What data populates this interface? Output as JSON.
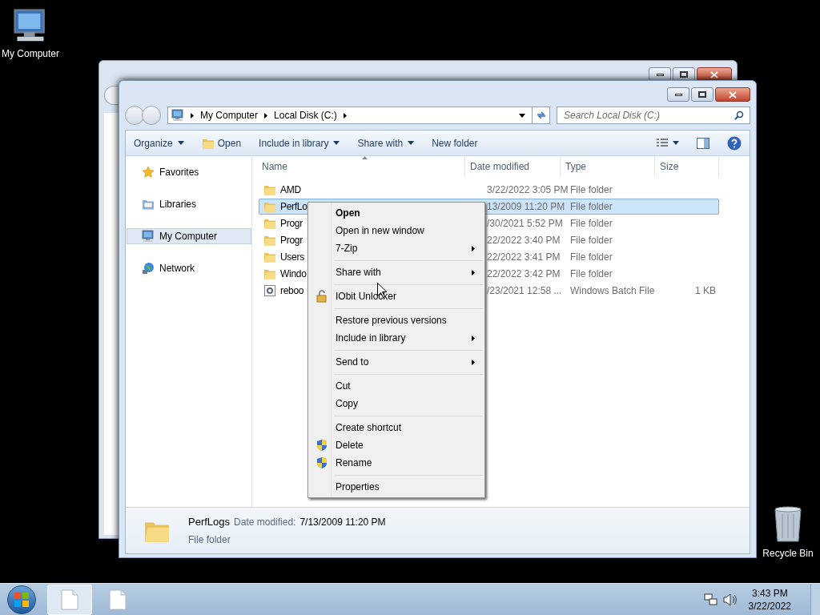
{
  "desktop_icons": [
    {
      "label": "My Computer",
      "kind": "computer"
    },
    {
      "label": "Recycle Bin",
      "kind": "bin"
    }
  ],
  "window": {
    "address": [
      "My Computer",
      "Local Disk (C:)"
    ],
    "search": {
      "placeholder": "Search Local Disk (C:)"
    },
    "toolbar": [
      {
        "label": "Organize",
        "kind": "dropdown"
      },
      {
        "label": "Open",
        "kind": "icon"
      },
      {
        "label": "Include in library",
        "kind": "dropdown"
      },
      {
        "label": "Share with",
        "kind": "dropdown"
      },
      {
        "label": "New folder",
        "kind": "plain"
      }
    ],
    "sidebar": [
      {
        "label": "Favorites",
        "kind": "star",
        "selected": false
      },
      {
        "label": "Libraries",
        "kind": "library",
        "selected": false
      },
      {
        "label": "My Computer",
        "kind": "computer",
        "selected": true
      },
      {
        "label": "Network",
        "kind": "network",
        "selected": false
      }
    ],
    "columns": [
      "Name",
      "Date modified",
      "Type",
      "Size"
    ],
    "rows": [
      {
        "name": "AMD",
        "date": "3/22/2022 3:05 PM",
        "type": "File folder",
        "kind": "folder",
        "selected": false
      },
      {
        "name": "PerfLo",
        "date": "13/2009 11:20 PM",
        "type": "File folder",
        "kind": "folder",
        "selected": true
      },
      {
        "name": "Progr",
        "date": "/30/2021 5:52 PM",
        "type": "File folder",
        "kind": "folder",
        "selected": false
      },
      {
        "name": "Progr",
        "date": "22/2022 3:40 PM",
        "type": "File folder",
        "kind": "folder",
        "selected": false
      },
      {
        "name": "Users",
        "date": "22/2022 3:41 PM",
        "type": "File folder",
        "kind": "folder",
        "selected": false
      },
      {
        "name": "Windo",
        "date": "22/2022 3:42 PM",
        "type": "File folder",
        "kind": "folder",
        "selected": false
      },
      {
        "name": "reboo",
        "date": "/23/2021 12:58 ...",
        "type": "Windows Batch File",
        "size": "1 KB",
        "kind": "batch",
        "selected": false
      }
    ],
    "details": {
      "name": "PerfLogs",
      "date_label": "Date modified:",
      "date": "7/13/2009 11:20 PM",
      "type": "File folder"
    }
  },
  "context_menu": [
    {
      "label": "Open",
      "kind": "plain",
      "bold": true,
      "submenu": false
    },
    {
      "label": "Open in new window",
      "kind": "plain",
      "bold": false,
      "submenu": false
    },
    {
      "label": "7-Zip",
      "kind": "plain",
      "bold": false,
      "submenu": true
    },
    {
      "kind": "separator"
    },
    {
      "label": "Share with",
      "kind": "plain",
      "bold": false,
      "submenu": true
    },
    {
      "kind": "separator"
    },
    {
      "label": "IObit Unlocker",
      "kind": "padlock",
      "bold": false,
      "submenu": false
    },
    {
      "kind": "separator"
    },
    {
      "label": "Restore previous versions",
      "kind": "plain",
      "bold": false,
      "submenu": false
    },
    {
      "label": "Include in library",
      "kind": "plain",
      "bold": false,
      "submenu": true
    },
    {
      "kind": "separator"
    },
    {
      "label": "Send to",
      "kind": "plain",
      "bold": false,
      "submenu": true
    },
    {
      "kind": "separator"
    },
    {
      "label": "Cut",
      "kind": "plain",
      "bold": false,
      "submenu": false
    },
    {
      "label": "Copy",
      "kind": "plain",
      "bold": false,
      "submenu": false
    },
    {
      "kind": "separator"
    },
    {
      "label": "Create shortcut",
      "kind": "plain",
      "bold": false,
      "submenu": false
    },
    {
      "label": "Delete",
      "kind": "shield",
      "bold": false,
      "submenu": false
    },
    {
      "label": "Rename",
      "kind": "shield",
      "bold": false,
      "submenu": false
    },
    {
      "kind": "separator"
    },
    {
      "label": "Properties",
      "kind": "plain",
      "bold": false,
      "submenu": false
    }
  ],
  "taskbar": {
    "buttons": [
      {
        "selected": true
      },
      {
        "selected": false
      }
    ],
    "time": "3:43 PM",
    "date": "3/22/2022"
  }
}
